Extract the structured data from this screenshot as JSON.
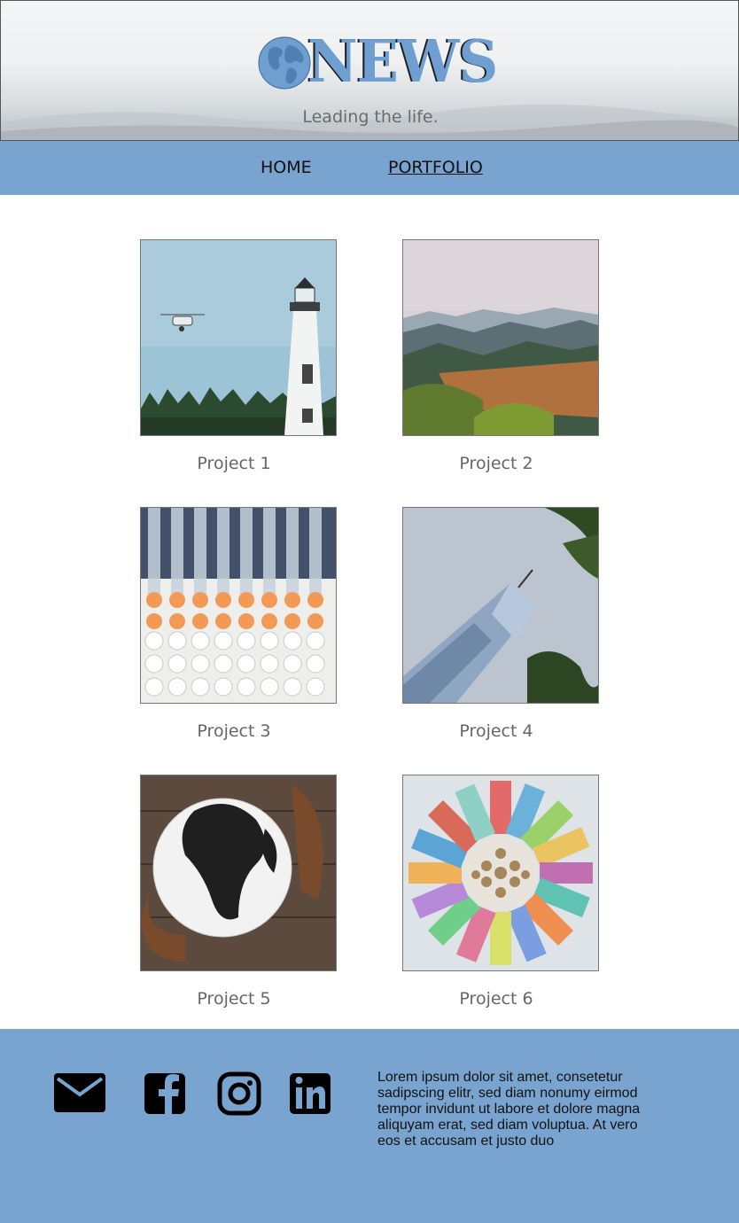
{
  "header": {
    "logo_text": "NEWS",
    "logo_icon": "globe-icon",
    "tagline": "Leading the life."
  },
  "nav": {
    "items": [
      {
        "label": "HOME",
        "active": false
      },
      {
        "label": "PORTFOLIO",
        "active": true
      }
    ]
  },
  "projects": [
    {
      "label": "Project 1",
      "image": "drone-lighthouse-photo"
    },
    {
      "label": "Project 2",
      "image": "mountain-landscape-photo"
    },
    {
      "label": "Project 3",
      "image": "lab-pipettes-photo"
    },
    {
      "label": "Project 4",
      "image": "skyscraper-photo"
    },
    {
      "label": "Project 5",
      "image": "hands-globe-photo"
    },
    {
      "label": "Project 6",
      "image": "world-currencies-photo"
    }
  ],
  "footer": {
    "social": [
      "mail-icon",
      "facebook-icon",
      "instagram-icon",
      "linkedin-icon"
    ],
    "text": "Lorem ipsum dolor sit amet, consetetur sadipscing elitr, sed diam nonumy eirmod tempor invidunt ut labore et dolore magna aliquyam erat, sed diam voluptua. At vero eos et accusam et justo duo"
  },
  "colors": {
    "nav_bg": "#78a4cf",
    "footer_bg": "#78a4cf",
    "logo_blue": "#6f9ed1",
    "label_gray": "#666666"
  }
}
